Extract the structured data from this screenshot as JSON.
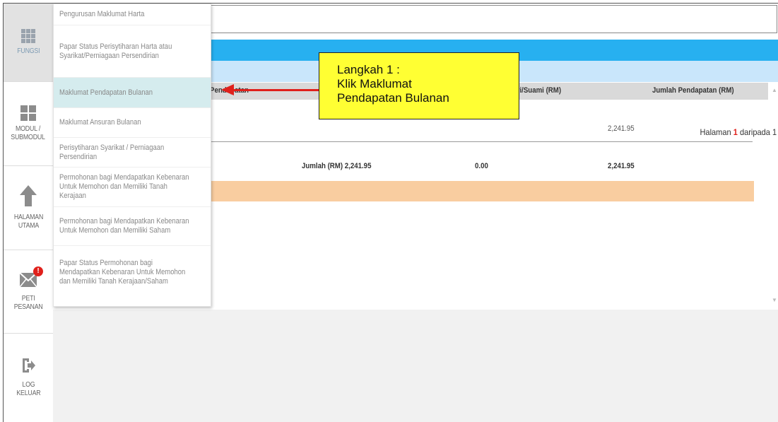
{
  "sidebar": {
    "fungsi": "FUNGSI",
    "modul": "MODUL /\nSUBMODUL",
    "halaman": "HALAMAN\nUTAMA",
    "peti": "PETI\nPESANAN",
    "peti_badge": "!",
    "log": "LOG\nKELUAR"
  },
  "menu": {
    "items": [
      "Pengurusan Maklumat Harta",
      "Papar Status Perisytiharan Harta atau Syarikat/Perniagaan Persendirian",
      "Maklumat Pendapatan Bulanan",
      "Maklumat Ansuran Bulanan",
      "Perisytiharan Syarikat / Perniagaan Persendirian",
      "Permohonan bagi Mendapatkan Kebenaran Untuk Memohon dan Memiliki Tanah Kerajaan",
      "Permohonan bagi Mendapatkan Kebenaran Untuk Memohon dan Memiliki Saham",
      "Papar Status Permohonan bagi Mendapatkan Kebenaran Untuk Memohon dan Memiliki Tanah Kerajaan/Saham"
    ],
    "highlighted_index": 2
  },
  "pager": {
    "prefix": "Halaman",
    "current": "1",
    "suffix": "daripada 1"
  },
  "table": {
    "headers": {
      "pendapatan": "Pendapatan",
      "isteri": "Isteri/Suami (RM)",
      "jumlah": "Jumlah Pendapatan (RM)"
    },
    "row_value": "2,241.95",
    "footer": {
      "total_label": "Jumlah (RM) 2,241.95",
      "isteri_total": "0.00",
      "grand_total": "2,241.95"
    }
  },
  "callout": {
    "line1": "Langkah 1 :",
    "line2": "Klik Maklumat",
    "line3": "Pendapatan Bulanan"
  },
  "colors": {
    "blue_bar": "#27b0f0",
    "light_blue_bar": "#c9e6fb",
    "orange_bar": "#f9cda0",
    "callout_bg": "#ffff33",
    "arrow": "#e0201b"
  }
}
